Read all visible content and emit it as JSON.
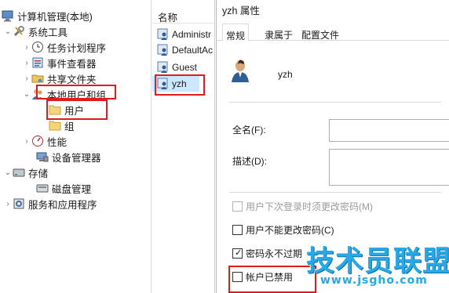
{
  "tree": {
    "root_label": "计算机管理(本地)",
    "system_tools_label": "系统工具",
    "task_scheduler_label": "任务计划程序",
    "event_viewer_label": "事件查看器",
    "shared_folders_label": "共享文件夹",
    "local_users_groups_label": "本地用户和组",
    "users_label": "用户",
    "groups_label": "组",
    "performance_label": "性能",
    "device_manager_label": "设备管理器",
    "storage_label": "存储",
    "disk_management_label": "磁盘管理",
    "services_apps_label": "服务和应用程序"
  },
  "list": {
    "header_name": "名称",
    "items": [
      "Administr",
      "DefaultAc",
      "Guest",
      "yzh"
    ]
  },
  "dialog": {
    "title": "yzh 属性",
    "tabs": [
      "常规",
      "隶属于",
      "配置文件"
    ],
    "active_tab": "常规",
    "username": "yzh",
    "fullname_label": "全名(F):",
    "fullname_value": "",
    "description_label": "描述(D):",
    "description_value": "",
    "checkboxes": {
      "must_change": {
        "label": "用户下次登录时须更改密码(M)",
        "checked": false,
        "disabled": true
      },
      "cannot_change": {
        "label": "用户不能更改密码(C)",
        "checked": false,
        "disabled": false
      },
      "never_expires": {
        "label": "密码永不过期",
        "checked": true,
        "disabled": false
      },
      "disabled_account": {
        "label": "帐户已禁用",
        "checked": false,
        "disabled": false
      }
    }
  },
  "watermark": {
    "name": "技术员联盟",
    "url": "www.jsgho.com"
  },
  "colors": {
    "highlight": "#e01b1b",
    "watermark": "#26a9e6",
    "selection": "#cce8ff"
  }
}
